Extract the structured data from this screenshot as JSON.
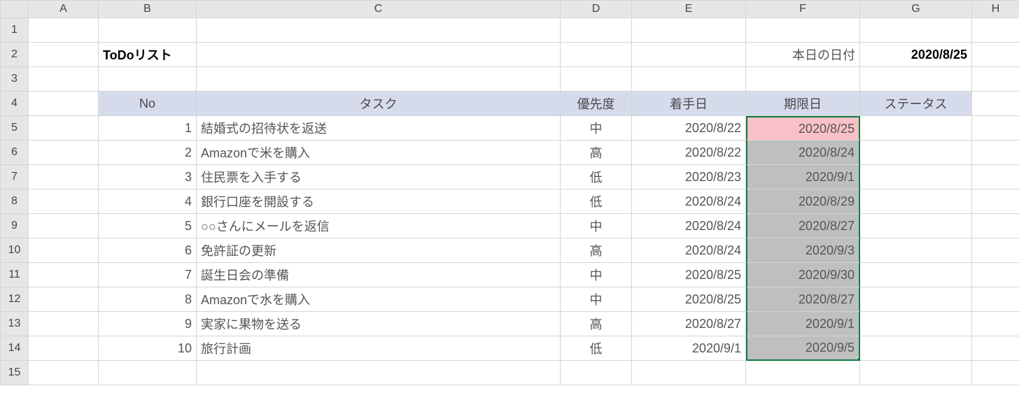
{
  "columns": [
    "A",
    "B",
    "C",
    "D",
    "E",
    "F",
    "G",
    "H"
  ],
  "rows": [
    "1",
    "2",
    "3",
    "4",
    "5",
    "6",
    "7",
    "8",
    "9",
    "10",
    "11",
    "12",
    "13",
    "14",
    "15"
  ],
  "title": "ToDoリスト",
  "today_label": "本日の日付",
  "today_value": "2020/8/25",
  "headers": {
    "no": "No",
    "task": "タスク",
    "priority": "優先度",
    "start": "着手日",
    "deadline": "期限日",
    "status": "ステータス"
  },
  "tasks": [
    {
      "no": "1",
      "task": "結婚式の招待状を返送",
      "priority": "中",
      "start": "2020/8/22",
      "deadline": "2020/8/25",
      "deadline_highlight": "pink"
    },
    {
      "no": "2",
      "task": "Amazonで米を購入",
      "priority": "高",
      "start": "2020/8/22",
      "deadline": "2020/8/24",
      "deadline_highlight": "gray"
    },
    {
      "no": "3",
      "task": "住民票を入手する",
      "priority": "低",
      "start": "2020/8/23",
      "deadline": "2020/9/1",
      "deadline_highlight": "gray"
    },
    {
      "no": "4",
      "task": "銀行口座を開設する",
      "priority": "低",
      "start": "2020/8/24",
      "deadline": "2020/8/29",
      "deadline_highlight": "gray"
    },
    {
      "no": "5",
      "task": "○○さんにメールを返信",
      "priority": "中",
      "start": "2020/8/24",
      "deadline": "2020/8/27",
      "deadline_highlight": "gray"
    },
    {
      "no": "6",
      "task": "免許証の更新",
      "priority": "高",
      "start": "2020/8/24",
      "deadline": "2020/9/3",
      "deadline_highlight": "gray"
    },
    {
      "no": "7",
      "task": "誕生日会の準備",
      "priority": "中",
      "start": "2020/8/25",
      "deadline": "2020/9/30",
      "deadline_highlight": "gray"
    },
    {
      "no": "8",
      "task": "Amazonで水を購入",
      "priority": "中",
      "start": "2020/8/25",
      "deadline": "2020/8/27",
      "deadline_highlight": "gray"
    },
    {
      "no": "9",
      "task": "実家に果物を送る",
      "priority": "高",
      "start": "2020/8/27",
      "deadline": "2020/9/1",
      "deadline_highlight": "gray"
    },
    {
      "no": "10",
      "task": "旅行計画",
      "priority": "低",
      "start": "2020/9/1",
      "deadline": "2020/9/5",
      "deadline_highlight": "gray"
    }
  ]
}
